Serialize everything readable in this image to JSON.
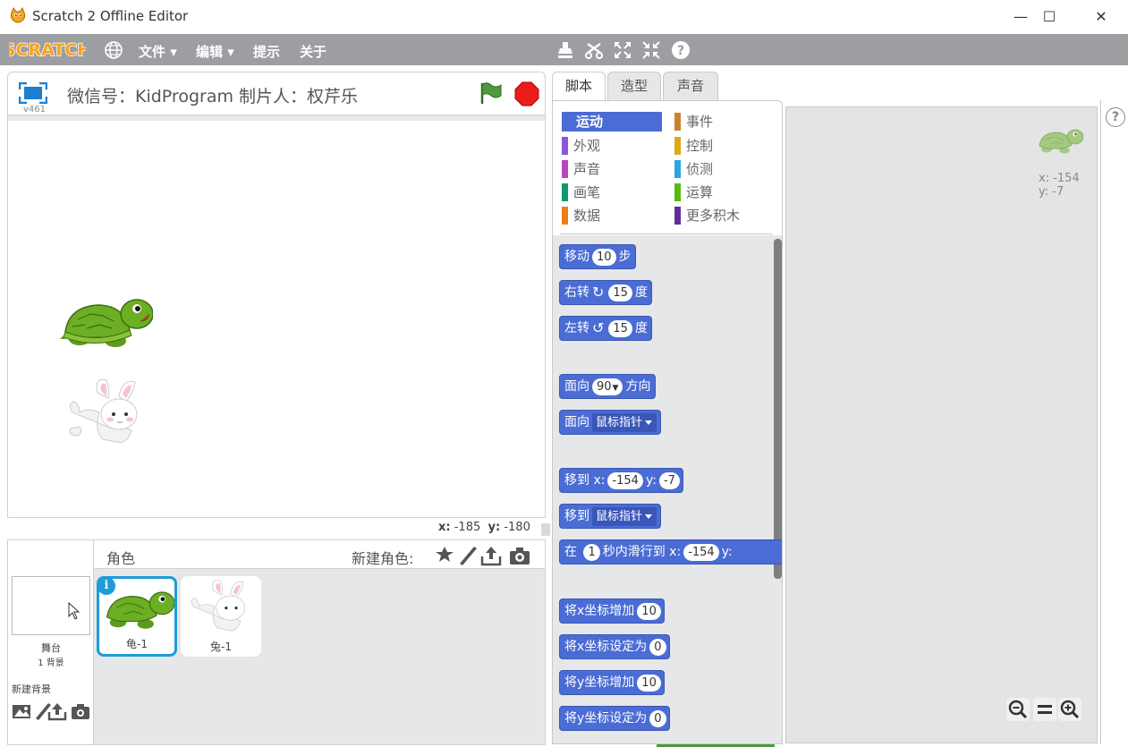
{
  "window": {
    "title": "Scratch 2 Offline Editor",
    "min_glyph": "—",
    "max_glyph": "☐",
    "close_glyph": "✕"
  },
  "menu": {
    "items": [
      "文件 ▾",
      "编辑 ▾",
      "提示",
      "关于"
    ]
  },
  "stage": {
    "title": "微信号：KidProgram 制片人：权芹乐",
    "version": "v461",
    "mouse_x_label": "x:",
    "mouse_x": "-185",
    "mouse_y_label": "y:",
    "mouse_y": "-180"
  },
  "sprites": {
    "header": "角色",
    "new_sprite_label": "新建角色:",
    "stage_name": "舞台",
    "stage_backdrops": "1 背景",
    "new_backdrop_label": "新建背景",
    "info_glyph": "i",
    "list": [
      {
        "name": "龟-1",
        "selected": true
      },
      {
        "name": "兔-1",
        "selected": false
      }
    ]
  },
  "tabs": [
    "脚本",
    "造型",
    "声音"
  ],
  "categories": [
    {
      "label": "运动",
      "color": "#4a6cd4",
      "active": true
    },
    {
      "label": "事件",
      "color": "#c88330"
    },
    {
      "label": "外观",
      "color": "#8a55d7"
    },
    {
      "label": "控制",
      "color": "#e1a91a"
    },
    {
      "label": "声音",
      "color": "#bb42c3"
    },
    {
      "label": "侦测",
      "color": "#2ca5e2"
    },
    {
      "label": "画笔",
      "color": "#0e9a6c"
    },
    {
      "label": "运算",
      "color": "#5cb712"
    },
    {
      "label": "数据",
      "color": "#ee7d16"
    },
    {
      "label": "更多积木",
      "color": "#632d99"
    }
  ],
  "blocks": {
    "move": {
      "a": "移动",
      "v": "10",
      "b": "步"
    },
    "turn_right": {
      "a": "右转",
      "v": "15",
      "b": "度"
    },
    "turn_left": {
      "a": "左转",
      "v": "15",
      "b": "度"
    },
    "point_dir": {
      "a": "面向",
      "v": "90",
      "b": "方向"
    },
    "point_towards": {
      "a": "面向",
      "dd": "鼠标指针"
    },
    "goto_xy": {
      "a": "移到 x:",
      "x": "-154",
      "yl": "y:",
      "y": "-7"
    },
    "goto": {
      "a": "移到",
      "dd": "鼠标指针"
    },
    "glide": {
      "a": "在",
      "t": "1",
      "b": "秒内滑行到 x:",
      "x": "-154",
      "yl": "y:"
    },
    "change_x": {
      "a": "将x坐标增加",
      "v": "10"
    },
    "set_x": {
      "a": "将x坐标设定为",
      "v": "0"
    },
    "change_y": {
      "a": "将y坐标增加",
      "v": "10"
    },
    "set_y": {
      "a": "将y坐标设定为",
      "v": "0"
    }
  },
  "script_area": {
    "x_label": "x: -154",
    "y_label": "y: -7"
  },
  "help_glyph": "?"
}
